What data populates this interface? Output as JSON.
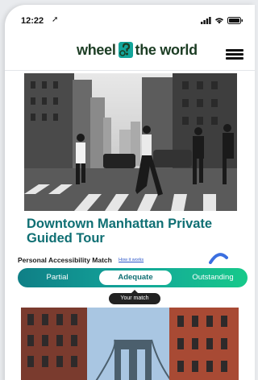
{
  "status": {
    "time": "12:22",
    "location_arrow": "➚"
  },
  "header": {
    "logo_left": "wheel",
    "logo_right": "the world",
    "logo_icon": "wheelchair-question-mark-logo"
  },
  "tour": {
    "title": "Downtown Manhattan Private Guided Tour",
    "photo": "street-crossing-photo"
  },
  "accessibility": {
    "label": "Personal Accessibility Match",
    "how_link": "How it works",
    "options": [
      "Partial",
      "Adequate",
      "Outstanding"
    ],
    "selected": "Adequate",
    "tooltip": "Your match"
  },
  "next_card": {
    "photo": "manhattan-bridge-photo"
  },
  "colors": {
    "brand_teal": "#0f6f73",
    "brand_dark_green": "#1c3d24",
    "gradient_start": "#0f7f86",
    "gradient_end": "#17c98a"
  }
}
